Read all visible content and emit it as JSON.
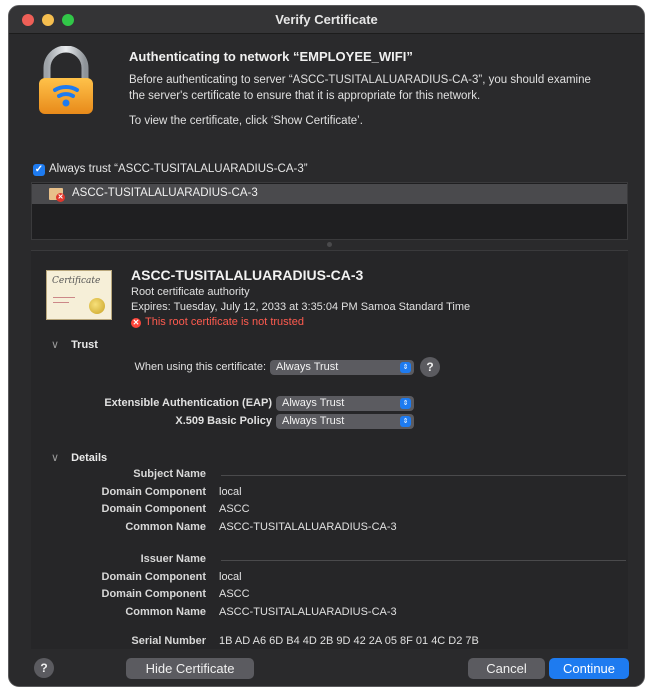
{
  "window": {
    "title": "Verify Certificate"
  },
  "header": {
    "heading": "Authenticating to network “EMPLOYEE_WIFI”",
    "paragraph": "Before authenticating to server “ASCC-TUSITALALUARADIUS-CA-3”, you should examine the server's certificate to ensure that it is appropriate for this network.",
    "instruction": "To view the certificate, click ‘Show Certificate’."
  },
  "always_trust": {
    "checked": true,
    "label": "Always trust “ASCC-TUSITALALUARADIUS-CA-3”"
  },
  "cert_list": {
    "items": [
      {
        "label": "ASCC-TUSITALALUARADIUS-CA-3"
      }
    ]
  },
  "certificate": {
    "icon_text": "Certificate",
    "name": "ASCC-TUSITALALUARADIUS-CA-3",
    "kind": "Root certificate authority",
    "expires": "Expires: Tuesday, July 12, 2033 at 3:35:04 PM Samoa Standard Time",
    "warning": "This root certificate is not trusted"
  },
  "trust": {
    "title": "Trust",
    "when_using_label": "When using this certificate:",
    "when_using_value": "Always Trust",
    "eap_label": "Extensible Authentication (EAP)",
    "eap_value": "Always Trust",
    "x509_label": "X.509 Basic Policy",
    "x509_value": "Always Trust"
  },
  "details": {
    "title": "Details",
    "subject_name_label": "Subject Name",
    "subject": [
      {
        "key": "Domain Component",
        "value": "local"
      },
      {
        "key": "Domain Component",
        "value": "ASCC"
      },
      {
        "key": "Common Name",
        "value": "ASCC-TUSITALALUARADIUS-CA-3"
      }
    ],
    "issuer_name_label": "Issuer Name",
    "issuer": [
      {
        "key": "Domain Component",
        "value": "local"
      },
      {
        "key": "Domain Component",
        "value": "ASCC"
      },
      {
        "key": "Common Name",
        "value": "ASCC-TUSITALALUARADIUS-CA-3"
      }
    ],
    "serial_label": "Serial Number",
    "serial_value": "1B AD A6 6D B4 4D 2B 9D 42 2A 05 8F 01 4C D2 7B"
  },
  "footer": {
    "help": "?",
    "hide_label": "Hide Certificate",
    "cancel_label": "Cancel",
    "continue_label": "Continue"
  },
  "colors": {
    "accent": "#1e7bf0",
    "warning": "#ff453a",
    "close": "#ee5f57",
    "minimize": "#f5be4f",
    "zoom": "#31c748"
  }
}
